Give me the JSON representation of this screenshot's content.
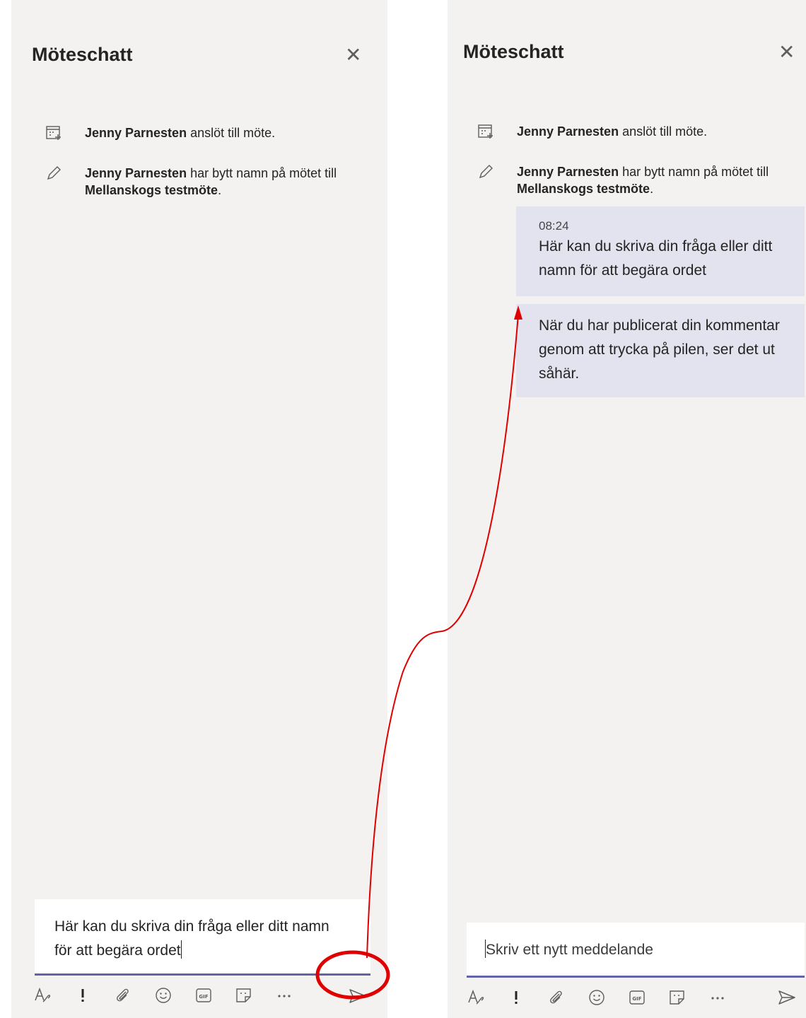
{
  "accent_color": "#6264a7",
  "annotation_color": "#e00000",
  "left_panel": {
    "title": "Möteschatt",
    "events": [
      {
        "icon": "calendar-join-icon",
        "name": "Jenny Parnesten",
        "text": " anslöt till möte."
      },
      {
        "icon": "pencil-icon",
        "name": "Jenny Parnesten",
        "text": " har bytt namn på mötet till ",
        "meeting": "Mellanskogs testmöte",
        "end": "."
      }
    ],
    "composer": {
      "value": "Här kan du skriva din fråga eller ditt namn för att begära ordet"
    }
  },
  "right_panel": {
    "title": "Möteschatt",
    "events": [
      {
        "icon": "calendar-join-icon",
        "name": "Jenny Parnesten",
        "text": " anslöt till möte."
      },
      {
        "icon": "pencil-icon",
        "name": "Jenny Parnesten",
        "text": " har bytt namn på mötet till ",
        "meeting": "Mellanskogs testmöte",
        "end": "."
      }
    ],
    "messages": [
      {
        "time": "08:24",
        "text": "Här kan du skriva din fråga eller ditt namn för att begära ordet"
      },
      {
        "text": "När du har publicerat din kommentar genom att trycka på pilen, ser det ut såhär."
      }
    ],
    "composer": {
      "placeholder": "Skriv ett nytt meddelande"
    }
  },
  "toolbar_icons": [
    "format-icon",
    "important-icon",
    "attach-icon",
    "emoji-icon",
    "gif-icon",
    "sticker-icon",
    "more-icon",
    "send-icon"
  ]
}
